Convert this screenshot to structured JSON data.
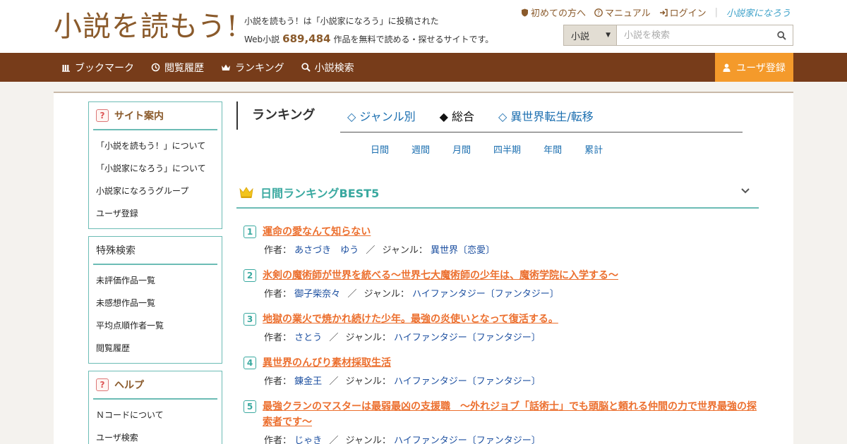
{
  "header": {
    "logo": "小説を読もう!",
    "tagline_line1": "小説を読もう！は「小説家になろう」に投稿された",
    "tagline_prefix": "Web小説",
    "work_count": "689,484",
    "tagline_suffix": "作品を無料で読める・探せるサイトです。",
    "links": [
      {
        "label": "初めての方へ",
        "icon": "shield-icon"
      },
      {
        "label": "マニュアル",
        "icon": "question-icon"
      },
      {
        "label": "ログイン",
        "icon": "login-icon"
      }
    ],
    "narou_logo": "小説家になろう"
  },
  "search": {
    "category": "小説",
    "placeholder": "小説を検索"
  },
  "nav": {
    "items": [
      {
        "label": "ブックマーク",
        "icon": "bookmark-icon"
      },
      {
        "label": "閲覧履歴",
        "icon": "history-icon"
      },
      {
        "label": "ランキング",
        "icon": "crown-icon"
      },
      {
        "label": "小説検索",
        "icon": "search-icon"
      }
    ],
    "register": "ユーザ登録"
  },
  "sidebar": {
    "site_guide": {
      "title": "サイト案内",
      "items": [
        "「小説を読もう！」について",
        "「小説家になろう」について",
        "小説家になろうグループ",
        "ユーザ登録"
      ]
    },
    "special_search": {
      "title": "特殊検索",
      "items": [
        "未評価作品一覧",
        "未感想作品一覧",
        "平均点順作者一覧",
        "閲覧履歴"
      ]
    },
    "help": {
      "title": "ヘルプ",
      "items": [
        "Ｎコードについて",
        "ユーザ検索"
      ]
    }
  },
  "ranking": {
    "heading": "ランキング",
    "tabs": [
      "◇ ジャンル別",
      "◆ 総合",
      "◇ 異世界転生/転移"
    ],
    "active_tab": 1,
    "periods": [
      "日間",
      "週間",
      "月間",
      "四半期",
      "年間",
      "累計"
    ],
    "best_title": "日間ランキングBEST5",
    "author_label": "作者：",
    "genre_label": "ジャンル：",
    "entries": [
      {
        "rank": "1",
        "title": "運命の愛なんて知らない",
        "author": "あさづき　ゆう",
        "genre": "異世界〔恋愛〕"
      },
      {
        "rank": "2",
        "title": "氷剣の魔術師が世界を統べる〜世界七大魔術師の少年は、魔術学院に入学する〜",
        "author": "御子柴奈々",
        "genre": "ハイファンタジー〔ファンタジー〕"
      },
      {
        "rank": "3",
        "title": "地獄の業火で焼かれ続けた少年。最強の炎使いとなって復活する。",
        "author": "さとう",
        "genre": "ハイファンタジー〔ファンタジー〕"
      },
      {
        "rank": "4",
        "title": "異世界のんびり素材採取生活",
        "author": "錬金王",
        "genre": "ハイファンタジー〔ファンタジー〕"
      },
      {
        "rank": "5",
        "title": "最強クランのマスターは最弱最凶の支援職　～外れジョブ「話術士」でも頭脳と頼れる仲間の力で世界最強の探索者です～",
        "author": "じゃき",
        "genre": "ハイファンタジー〔ファンタジー〕"
      }
    ]
  },
  "colors": {
    "brown": "#773c1a",
    "orange": "#f49a2b",
    "teal": "#6cbcb5",
    "title_orange": "#ec6f2e",
    "link_blue": "#1c4fa0"
  }
}
